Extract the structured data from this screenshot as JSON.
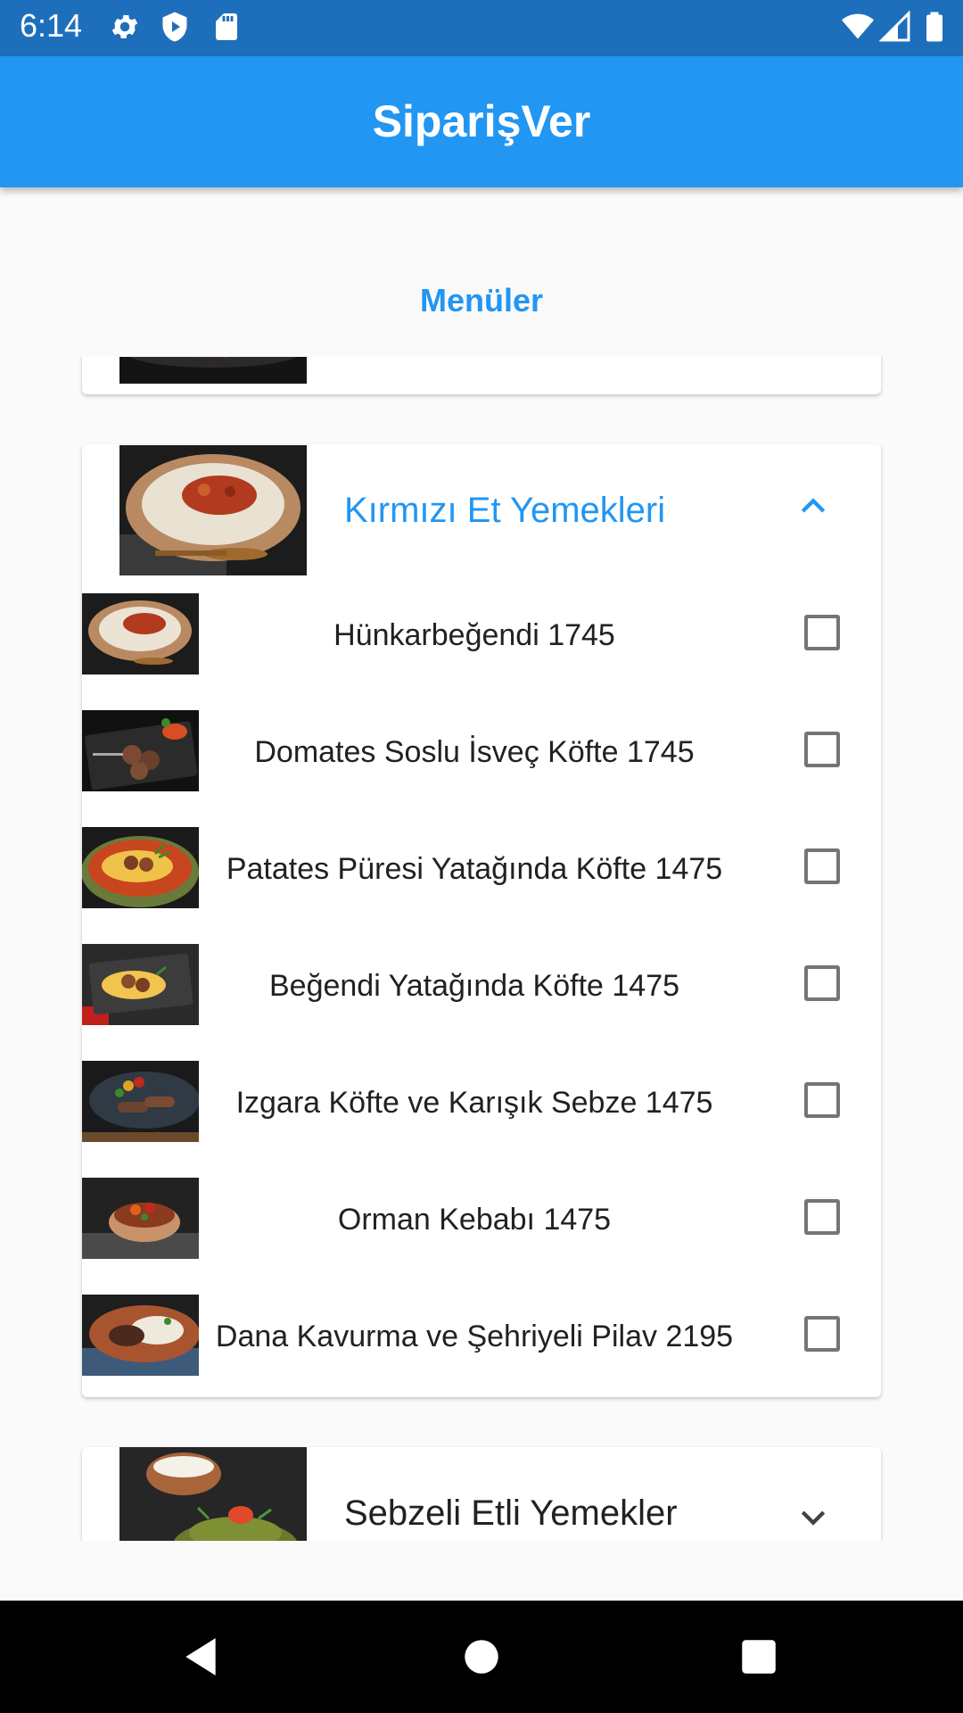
{
  "status": {
    "time": "6:14"
  },
  "app_bar": {
    "title": "SiparişVer"
  },
  "section": {
    "title": "Menüler"
  },
  "open_category": {
    "title": "Kırmızı Et Yemekleri",
    "items": [
      {
        "label": "Hünkarbeğendi          1745"
      },
      {
        "label": "Domates Soslu İsveç Köfte    1745"
      },
      {
        "label": "Patates Püresi Yatağında Köfte  1475"
      },
      {
        "label": "Beğendi Yatağında Köfte     1475"
      },
      {
        "label": "Izgara Köfte ve Karışık Sebze   1475"
      },
      {
        "label": "Orman Kebabı           1475"
      },
      {
        "label": "Dana Kavurma ve Şehriyeli Pilav 2195"
      }
    ]
  },
  "next_category": {
    "title": "Sebzeli Etli Yemekler"
  },
  "colors": {
    "primary": "#2196f3",
    "status_bar": "#1e6fbb",
    "text": "#212121",
    "checkbox_border": "#757575"
  },
  "icons": [
    "settings-icon",
    "shield-play-icon",
    "sd-card-icon",
    "wifi-icon",
    "signal-icon",
    "battery-icon",
    "chevron-up-icon",
    "chevron-down-icon",
    "back-icon",
    "home-icon",
    "recents-icon"
  ]
}
